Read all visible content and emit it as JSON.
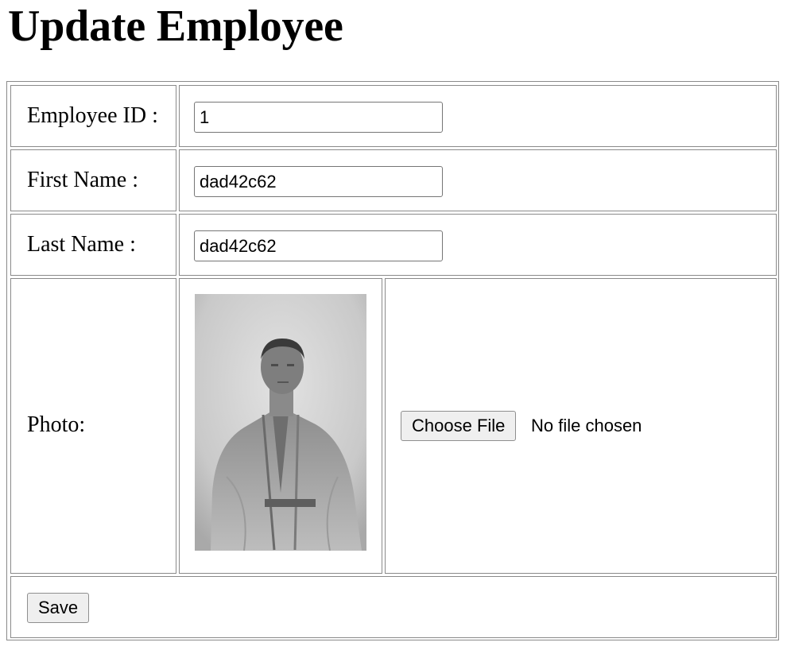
{
  "page": {
    "title": "Update Employee"
  },
  "form": {
    "employee_id": {
      "label": "Employee ID :",
      "value": "1"
    },
    "first_name": {
      "label": "First Name :",
      "value": "dad42c62"
    },
    "last_name": {
      "label": "Last Name :",
      "value": "dad42c62"
    },
    "photo": {
      "label": "Photo:",
      "choose_button": "Choose File",
      "file_status": "No file chosen"
    },
    "save_button": "Save"
  }
}
